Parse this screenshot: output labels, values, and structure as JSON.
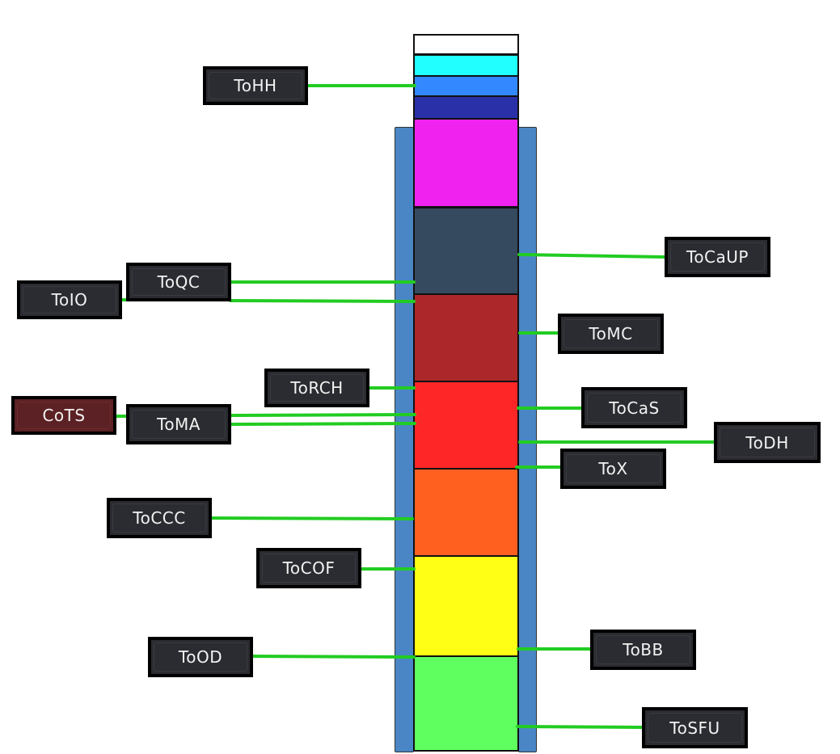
{
  "diagram": {
    "stack_blocks": [
      {
        "id": "white",
        "color": "#ffffff"
      },
      {
        "id": "cyan",
        "color": "#22ffff"
      },
      {
        "id": "lightblue",
        "color": "#3388ff"
      },
      {
        "id": "navy",
        "color": "#2a30a8"
      },
      {
        "id": "magenta",
        "color": "#f022f0"
      },
      {
        "id": "slate",
        "color": "#354a5f"
      },
      {
        "id": "darkred",
        "color": "#ab272a"
      },
      {
        "id": "red",
        "color": "#ff2628"
      },
      {
        "id": "orange",
        "color": "#ff6020"
      },
      {
        "id": "yellow",
        "color": "#ffff16"
      },
      {
        "id": "green",
        "color": "#5fff5f"
      }
    ],
    "rail_color": "#4a86c5",
    "connector_color": "#22cc22",
    "labels": [
      {
        "text": "ToHH",
        "style": "dark"
      },
      {
        "text": "ToQC",
        "style": "dark"
      },
      {
        "text": "ToIO",
        "style": "dark"
      },
      {
        "text": "ToRCH",
        "style": "dark"
      },
      {
        "text": "CoTS",
        "style": "maroon"
      },
      {
        "text": "ToMA",
        "style": "dark"
      },
      {
        "text": "ToCCC",
        "style": "dark"
      },
      {
        "text": "ToCOF",
        "style": "dark"
      },
      {
        "text": "ToOD",
        "style": "dark"
      },
      {
        "text": "ToCaUP",
        "style": "dark"
      },
      {
        "text": "ToMC",
        "style": "dark"
      },
      {
        "text": "ToCaS",
        "style": "dark"
      },
      {
        "text": "ToDH",
        "style": "dark"
      },
      {
        "text": "ToX",
        "style": "dark"
      },
      {
        "text": "ToBB",
        "style": "dark"
      },
      {
        "text": "ToSFU",
        "style": "dark"
      }
    ]
  }
}
